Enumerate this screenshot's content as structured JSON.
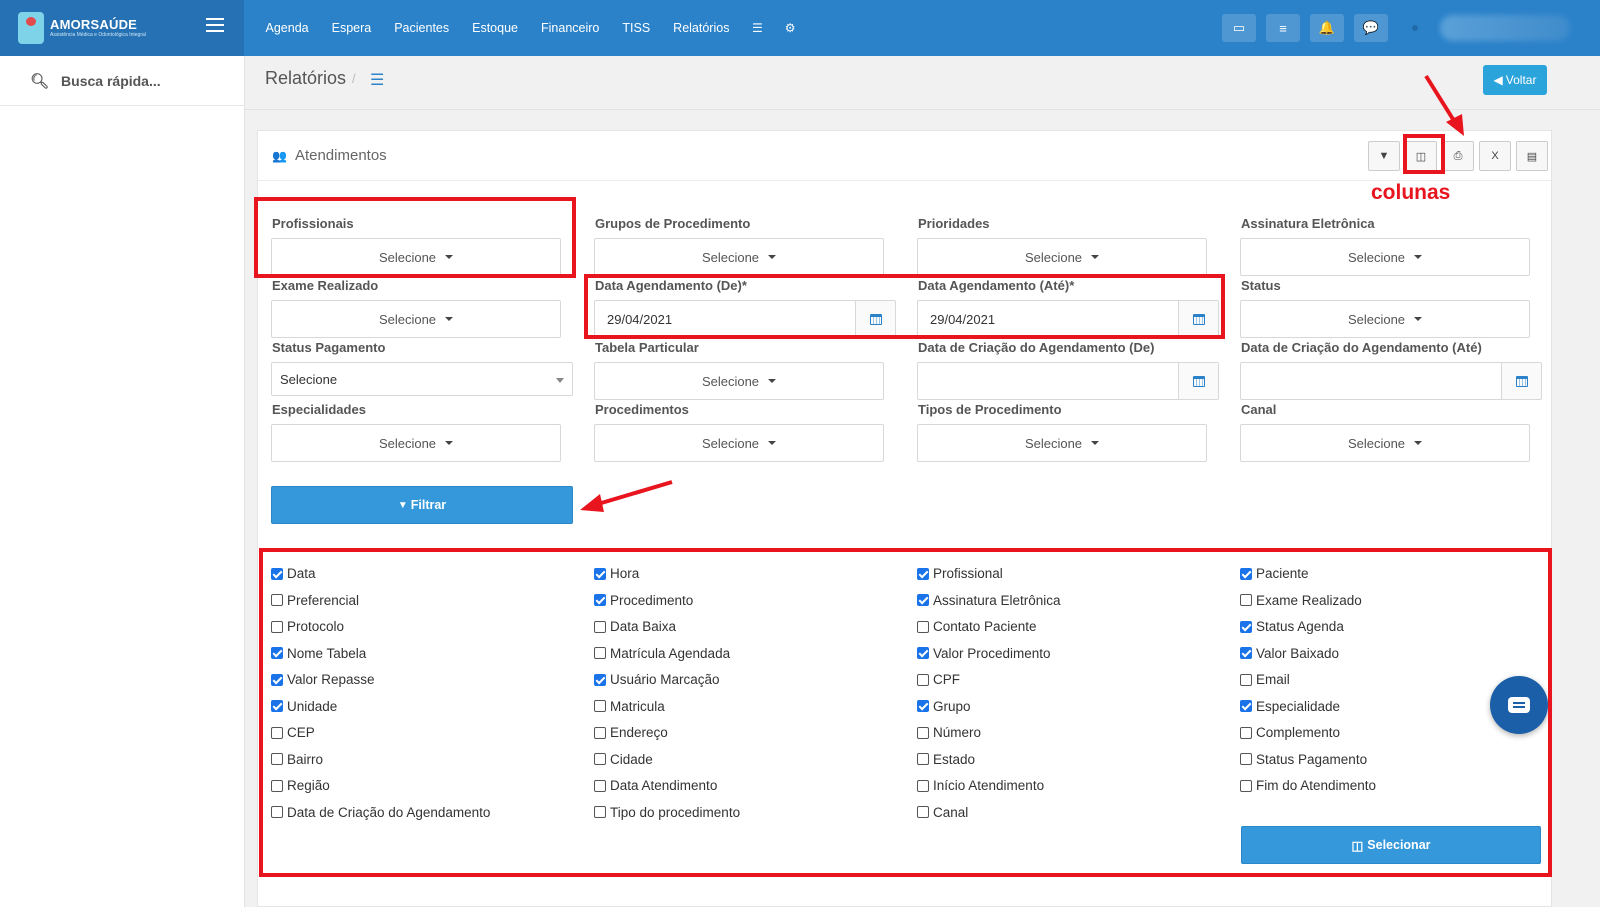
{
  "brand": {
    "name": "AMORSAÚDE",
    "tagline": "Assistência Médica e Odontológica Integral"
  },
  "nav": {
    "items": [
      "Agenda",
      "Espera",
      "Pacientes",
      "Estoque",
      "Financeiro",
      "TISS",
      "Relatórios"
    ]
  },
  "sidebar": {
    "search_placeholder": "Busca rápida..."
  },
  "breadcrumb": {
    "title": "Relatórios",
    "separator": "/"
  },
  "back_button": "Voltar",
  "panel": {
    "title": "Atendimentos"
  },
  "form": {
    "profissionais": {
      "label": "Profissionais",
      "value": "Selecione"
    },
    "grupos": {
      "label": "Grupos de Procedimento",
      "value": "Selecione"
    },
    "prioridades": {
      "label": "Prioridades",
      "value": "Selecione"
    },
    "assinatura": {
      "label": "Assinatura Eletrônica",
      "value": "Selecione"
    },
    "exame": {
      "label": "Exame Realizado",
      "value": "Selecione"
    },
    "data_de": {
      "label": "Data Agendamento (De)*",
      "value": "29/04/2021"
    },
    "data_ate": {
      "label": "Data Agendamento (Até)*",
      "value": "29/04/2021"
    },
    "status": {
      "label": "Status",
      "value": "Selecione"
    },
    "status_pagamento": {
      "label": "Status Pagamento",
      "value": "Selecione"
    },
    "tabela": {
      "label": "Tabela Particular",
      "value": "Selecione"
    },
    "criacao_de": {
      "label": "Data de Criação do Agendamento (De)",
      "value": ""
    },
    "criacao_ate": {
      "label": "Data de Criação do Agendamento (Até)",
      "value": ""
    },
    "especialidades": {
      "label": "Especialidades",
      "value": "Selecione"
    },
    "procedimentos": {
      "label": "Procedimentos",
      "value": "Selecione"
    },
    "tipos": {
      "label": "Tipos de Procedimento",
      "value": "Selecione"
    },
    "canal": {
      "label": "Canal",
      "value": "Selecione"
    }
  },
  "filter_button": "Filtrar",
  "columns": [
    [
      {
        "label": "Data",
        "checked": true
      },
      {
        "label": "Preferencial",
        "checked": false
      },
      {
        "label": "Protocolo",
        "checked": false
      },
      {
        "label": "Nome Tabela",
        "checked": true
      },
      {
        "label": "Valor Repasse",
        "checked": true
      },
      {
        "label": "Unidade",
        "checked": true
      },
      {
        "label": "CEP",
        "checked": false
      },
      {
        "label": "Bairro",
        "checked": false
      },
      {
        "label": "Região",
        "checked": false
      },
      {
        "label": "Data de Criação do Agendamento",
        "checked": false
      }
    ],
    [
      {
        "label": "Hora",
        "checked": true
      },
      {
        "label": "Procedimento",
        "checked": true
      },
      {
        "label": "Data Baixa",
        "checked": false
      },
      {
        "label": "Matrícula Agendada",
        "checked": false
      },
      {
        "label": "Usuário Marcação",
        "checked": true
      },
      {
        "label": "Matricula",
        "checked": false
      },
      {
        "label": "Endereço",
        "checked": false
      },
      {
        "label": "Cidade",
        "checked": false
      },
      {
        "label": "Data Atendimento",
        "checked": false
      },
      {
        "label": "Tipo do procedimento",
        "checked": false
      }
    ],
    [
      {
        "label": "Profissional",
        "checked": true
      },
      {
        "label": "Assinatura Eletrônica",
        "checked": true
      },
      {
        "label": "Contato Paciente",
        "checked": false
      },
      {
        "label": "Valor Procedimento",
        "checked": true
      },
      {
        "label": "CPF",
        "checked": false
      },
      {
        "label": "Grupo",
        "checked": true
      },
      {
        "label": "Número",
        "checked": false
      },
      {
        "label": "Estado",
        "checked": false
      },
      {
        "label": "Início Atendimento",
        "checked": false
      },
      {
        "label": "Canal",
        "checked": false
      }
    ],
    [
      {
        "label": "Paciente",
        "checked": true
      },
      {
        "label": "Exame Realizado",
        "checked": false
      },
      {
        "label": "Status Agenda",
        "checked": true
      },
      {
        "label": "Valor Baixado",
        "checked": true
      },
      {
        "label": "Email",
        "checked": false
      },
      {
        "label": "Especialidade",
        "checked": true
      },
      {
        "label": "Complemento",
        "checked": false
      },
      {
        "label": "Status Pagamento",
        "checked": false
      },
      {
        "label": "Fim do Atendimento",
        "checked": false
      }
    ]
  ],
  "select_button": "Selecionar",
  "annotation": {
    "text": "colunas",
    "color": "#e8141e"
  },
  "colors": {
    "topbar": "#2b82c9",
    "primary_button": "#3498db",
    "annotation": "#e8141e"
  }
}
